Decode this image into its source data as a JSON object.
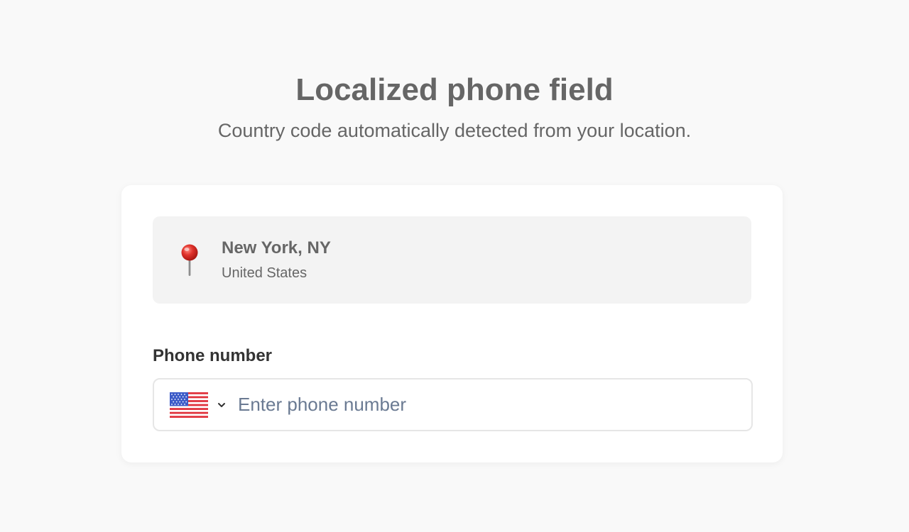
{
  "header": {
    "title": "Localized phone field",
    "subtitle": "Country code automatically detected from your location."
  },
  "location": {
    "icon": "map-pin-icon",
    "city": "New York, NY",
    "country": "United States"
  },
  "phone": {
    "label": "Phone number",
    "placeholder": "Enter phone number",
    "value": "",
    "country_flag": "us-flag-icon",
    "dropdown_icon": "chevron-down-icon"
  },
  "colors": {
    "background": "#f9f9f9",
    "card": "#ffffff",
    "location_bg": "#f3f3f3",
    "pin_red": "#e0322b",
    "placeholder": "#6a7a92",
    "flag_blue": "#3c5bc8",
    "flag_red": "#e0323c"
  }
}
